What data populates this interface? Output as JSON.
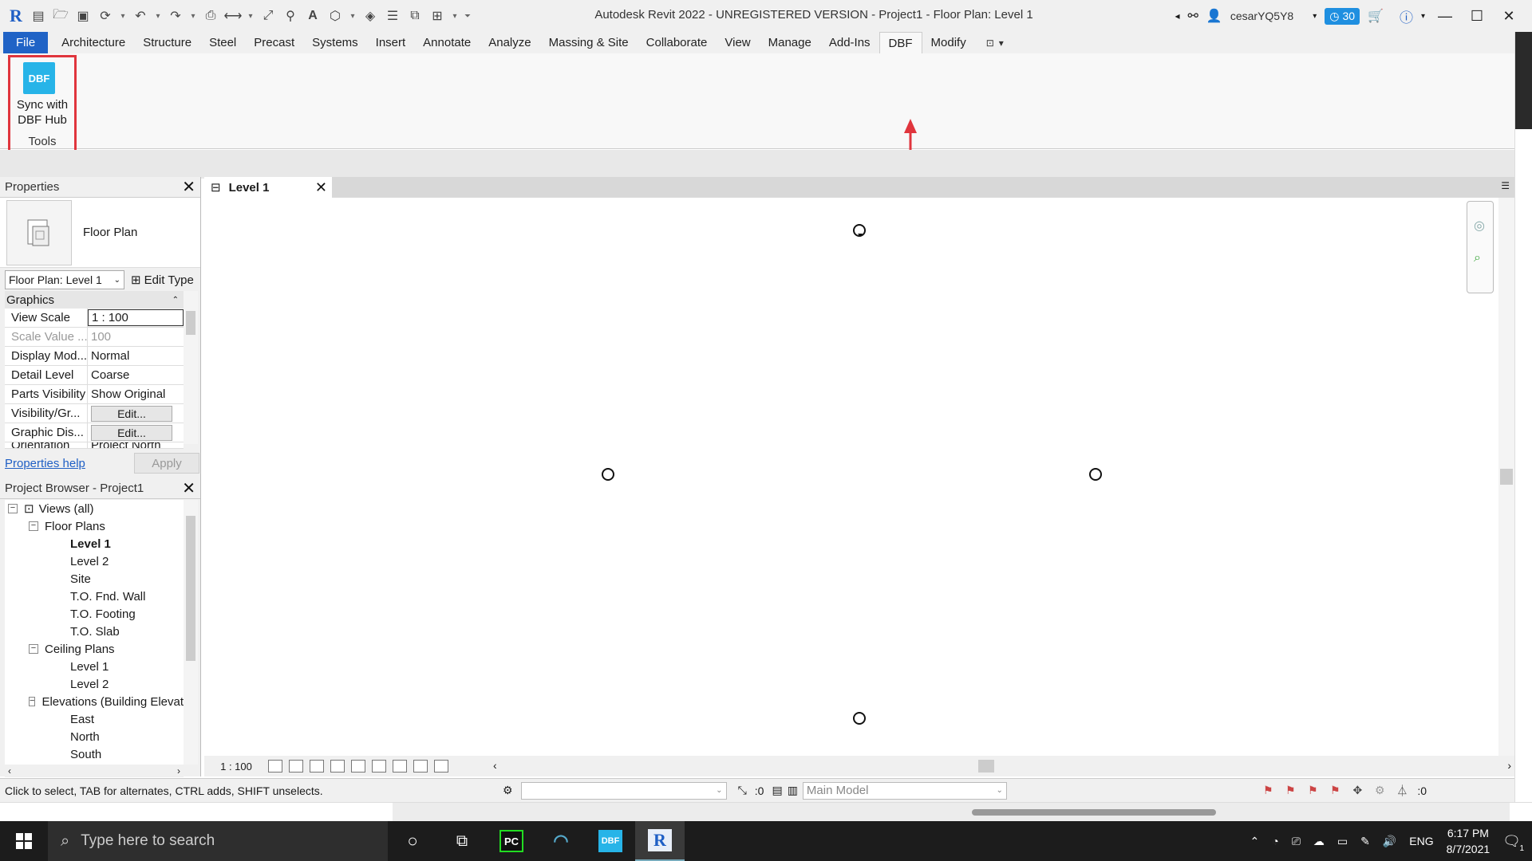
{
  "app": {
    "title": "Autodesk Revit 2022 - UNREGISTERED VERSION - Project1 - Floor Plan: Level 1",
    "user": "cesarYQ5Y8",
    "trial_days": "30"
  },
  "ribbon": {
    "tabs": [
      "File",
      "Architecture",
      "Structure",
      "Steel",
      "Precast",
      "Systems",
      "Insert",
      "Annotate",
      "Analyze",
      "Massing & Site",
      "Collaborate",
      "View",
      "Manage",
      "Add-Ins",
      "DBF",
      "Modify"
    ],
    "active_tab": "DBF",
    "panel": {
      "icon_text": "DBF",
      "button_label_line1": "Sync with",
      "button_label_line2": "DBF Hub",
      "panel_label": "Tools"
    },
    "highlight_color": "#e0353d"
  },
  "properties": {
    "title": "Properties",
    "type_name": "Floor Plan",
    "filter_value": "Floor Plan: Level 1",
    "edit_type_label": "Edit Type",
    "section": "Graphics",
    "rows": [
      {
        "key": "View Scale",
        "value": "1 : 100"
      },
      {
        "key": "Scale Value ...",
        "value": "100"
      },
      {
        "key": "Display Mod...",
        "value": "Normal"
      },
      {
        "key": "Detail Level",
        "value": "Coarse"
      },
      {
        "key": "Parts Visibility",
        "value": "Show Original"
      },
      {
        "key": "Visibility/Gr...",
        "value": "Edit..."
      },
      {
        "key": "Graphic Dis...",
        "value": "Edit..."
      },
      {
        "key": "Orientation",
        "value": "Project North"
      }
    ],
    "help_link": "Properties help",
    "apply_label": "Apply"
  },
  "browser": {
    "title": "Project Browser - Project1",
    "items": [
      {
        "label": "Views (all)",
        "level": 0,
        "expander": "−"
      },
      {
        "label": "Floor Plans",
        "level": 1,
        "expander": "−"
      },
      {
        "label": "Level 1",
        "level": 2,
        "bold": true
      },
      {
        "label": "Level 2",
        "level": 2
      },
      {
        "label": "Site",
        "level": 2
      },
      {
        "label": "T.O. Fnd. Wall",
        "level": 2
      },
      {
        "label": "T.O. Footing",
        "level": 2
      },
      {
        "label": "T.O. Slab",
        "level": 2
      },
      {
        "label": "Ceiling Plans",
        "level": 1,
        "expander": "−"
      },
      {
        "label": "Level 1",
        "level": 2
      },
      {
        "label": "Level 2",
        "level": 2
      },
      {
        "label": "Elevations (Building Elevation)",
        "level": 1,
        "expander": "−"
      },
      {
        "label": "East",
        "level": 2
      },
      {
        "label": "North",
        "level": 2
      },
      {
        "label": "South",
        "level": 2
      }
    ]
  },
  "view": {
    "tab_label": "Level 1",
    "scale": "1 : 100"
  },
  "status": {
    "text": "Click to select, TAB for alternates, CTRL adds, SHIFT unselects.",
    "workset_count": ":0",
    "model": "Main Model",
    "filter_count": ":0"
  },
  "taskbar": {
    "search_placeholder": "Type here to search",
    "apps": [
      "PyCharm",
      "Browser",
      "DBF",
      "Revit"
    ],
    "language": "ENG",
    "time": "6:17 PM",
    "date": "8/7/2021",
    "notifications": "1"
  }
}
